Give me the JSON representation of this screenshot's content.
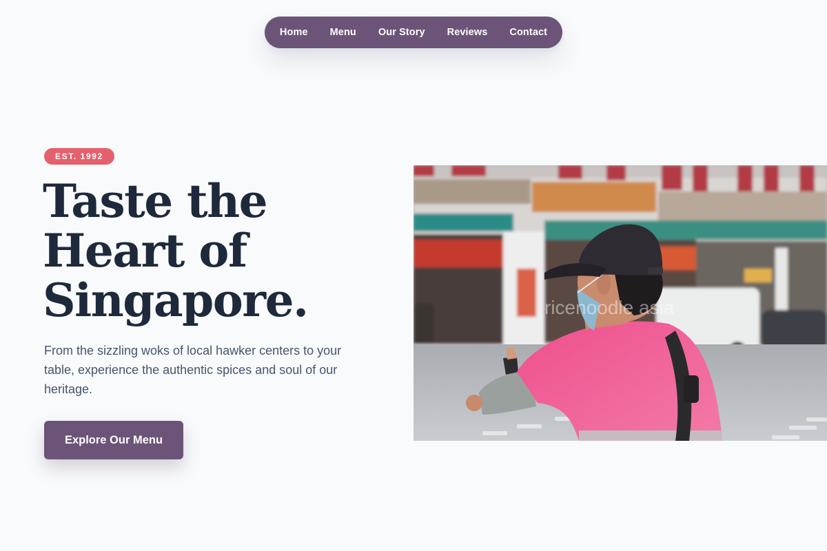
{
  "nav": {
    "items": [
      {
        "label": "Home"
      },
      {
        "label": "Menu"
      },
      {
        "label": "Our Story"
      },
      {
        "label": "Reviews"
      },
      {
        "label": "Contact"
      }
    ]
  },
  "hero": {
    "badge": "EST. 1992",
    "headline": {
      "line1": "Taste the",
      "line2": "Heart of",
      "line3": "Singapore."
    },
    "description": "From the sizzling woks of local hawker centers to your table, experience the authentic spices and soul of our heritage.",
    "cta_label": "Explore Our Menu",
    "image": {
      "alt": "",
      "watermark": "ricenoodle asia"
    }
  },
  "colors": {
    "background": "#f8fafc",
    "nav_bg": "#6b5478",
    "badge_bg": "#e4606d",
    "headline": "#1e293b",
    "body_text": "#475569",
    "button_bg": "#6b5478"
  }
}
